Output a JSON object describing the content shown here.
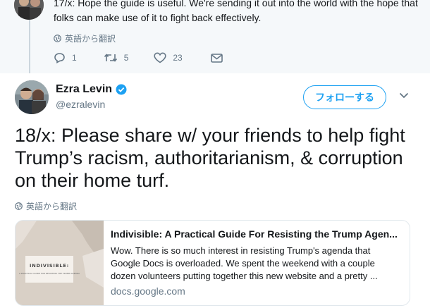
{
  "previous_tweet": {
    "text": "17/x: Hope the guide is useful. We're sending it out into the world with the hope that folks can make use of it to fight back effectively.",
    "translate_label": "英語から翻訳",
    "replies": "1",
    "retweets": "5",
    "likes": "23"
  },
  "tweet": {
    "author_name": "Ezra Levin",
    "author_handle": "@ezralevin",
    "follow_label": "フォローする",
    "text": "18/x: Please share w/ your friends to help fight Trump’s racism, authoritarianism, & corruption on their home turf.",
    "translate_label": "英語から翻訳"
  },
  "link_card": {
    "image_title": "INDIVISIBLE:",
    "image_subtitle": "A PRACTICAL GUIDE FOR RESISTING THE TRUMP AGENDA",
    "title": "Indivisible: A Practical Guide For Resisting the Trump Agen...",
    "description": "Wow. There is so much interest in resisting Trump's agenda that Google Docs is overloaded. We spent the weekend with a couple dozen volunteers putting together this new website and a pretty ...",
    "domain": "docs.google.com"
  },
  "colors": {
    "accent": "#1da1f2",
    "muted": "#657786",
    "verified": "#1da1f2"
  }
}
